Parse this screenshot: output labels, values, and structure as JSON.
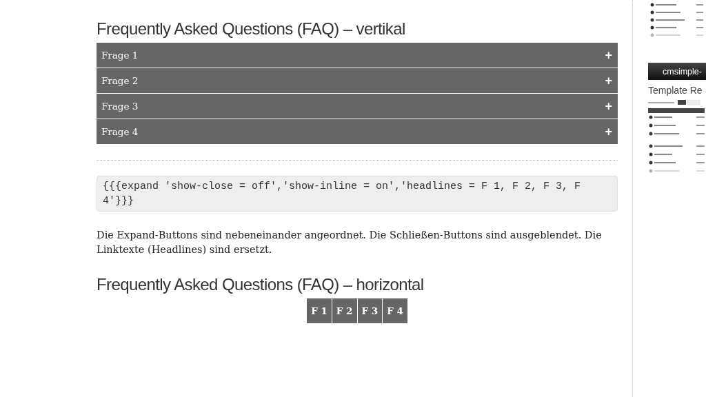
{
  "sections": [
    {
      "kind": "accordion",
      "heading": "Frequently Asked Questions (FAQ) – vertikal",
      "items": [
        {
          "label": "Frage 1",
          "icon": "+"
        },
        {
          "label": "Frage 2",
          "icon": "+"
        },
        {
          "label": "Frage 3",
          "icon": "+"
        },
        {
          "label": "Frage 4",
          "icon": "+"
        }
      ]
    },
    {
      "kind": "code",
      "code": "{{{expand 'show-close = off','show-inline = on','headlines = F 1, F 2, F 3, F 4'}}}"
    },
    {
      "kind": "paragraph",
      "text": "Die Expand-Buttons sind nebeneinander angeordnet. Die Schließen-Buttons sind ausgeblendet. Die Linktexte (Headlines) sind ersetzt."
    },
    {
      "kind": "tabs",
      "heading": "Frequently Asked Questions (FAQ) – horizontal",
      "items": [
        {
          "label": "F 1"
        },
        {
          "label": "F 2"
        },
        {
          "label": "F 3"
        },
        {
          "label": "F 4"
        }
      ]
    }
  ],
  "sidebar": {
    "banner": "cmsimple-",
    "title": "Template Re"
  }
}
